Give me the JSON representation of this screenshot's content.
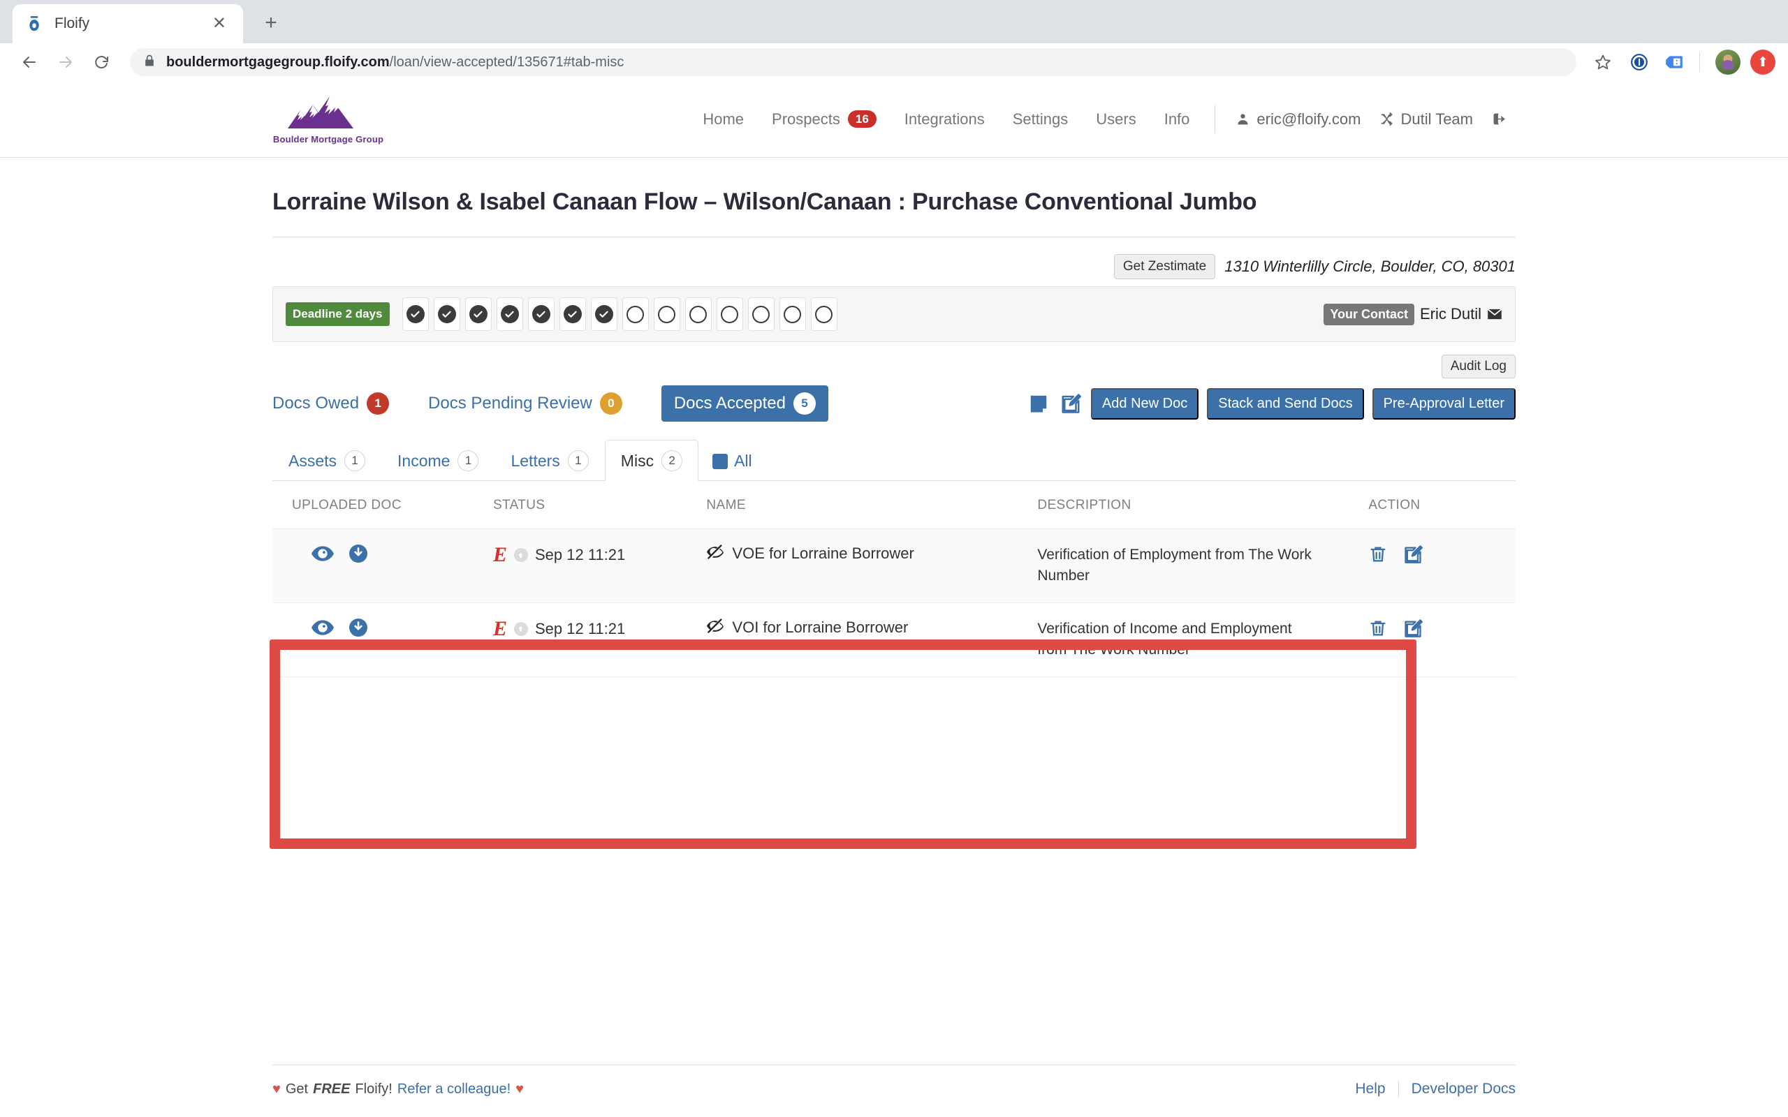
{
  "browser": {
    "tab_title": "Floify",
    "tab_favicon_name": "floify-favicon",
    "close_label": "✕",
    "newtab_label": "+",
    "url_host": "bouldermortgagegroup.floify.com",
    "url_path": "/loan/view-accepted/135671#tab-misc",
    "back_label": "←",
    "forward_label": "→",
    "reload_label": "⟳",
    "star_label": "☆",
    "update_label": "⬆"
  },
  "header": {
    "logo_text": "Boulder Mortgage Group",
    "nav": [
      {
        "label": "Home",
        "badge": null
      },
      {
        "label": "Prospects",
        "badge": "16"
      },
      {
        "label": "Integrations",
        "badge": null
      },
      {
        "label": "Settings",
        "badge": null
      },
      {
        "label": "Users",
        "badge": null
      },
      {
        "label": "Info",
        "badge": null
      }
    ],
    "user_email": "eric@floify.com",
    "team_name": "Dutil Team"
  },
  "loan": {
    "title": "Lorraine Wilson & Isabel Canaan Flow – Wilson/Canaan : Purchase Conventional Jumbo",
    "zestimate_label": "Get Zestimate",
    "address": "1310 Winterlilly Circle, Boulder, CO, 80301",
    "deadline_label": "Deadline 2 days",
    "steps_completed": 7,
    "steps_total": 14,
    "contact_label": "Your Contact",
    "contact_name": "Eric Dutil"
  },
  "toolbar": {
    "audit_log_label": "Audit Log",
    "add_new_doc_label": "Add New Doc",
    "stack_send_label": "Stack and Send Docs",
    "pre_approval_label": "Pre-Approval Letter"
  },
  "doc_status_tabs": [
    {
      "label": "Docs Owed",
      "count": "1",
      "state": "owed",
      "active": false
    },
    {
      "label": "Docs Pending Review",
      "count": "0",
      "state": "pending",
      "active": false
    },
    {
      "label": "Docs Accepted",
      "count": "5",
      "state": "accepted",
      "active": true
    }
  ],
  "category_tabs": [
    {
      "label": "Assets",
      "count": "1",
      "active": false
    },
    {
      "label": "Income",
      "count": "1",
      "active": false
    },
    {
      "label": "Letters",
      "count": "1",
      "active": false
    },
    {
      "label": "Misc",
      "count": "2",
      "active": true
    }
  ],
  "all_filter_label": "All",
  "table": {
    "headers": {
      "uploaded_doc": "UPLOADED DOC",
      "status": "STATUS",
      "name": "NAME",
      "description": "DESCRIPTION",
      "action": "ACTION"
    },
    "rows": [
      {
        "status_source": "E",
        "status_date": "Sep 12 11:21",
        "name": "VOE for Lorraine Borrower",
        "description": "Verification of Employment from The Work Number"
      },
      {
        "status_source": "E",
        "status_date": "Sep 12 11:21",
        "name": "VOI for Lorraine Borrower",
        "description": "Verification of Income and Employment from The Work Number"
      }
    ]
  },
  "footer": {
    "promo_prefix": "Get",
    "promo_free": "FREE",
    "promo_mid": "Floify!",
    "promo_link": "Refer a colleague!",
    "help_label": "Help",
    "dev_docs_label": "Developer Docs"
  },
  "colors": {
    "brand_purple": "#6b2f90",
    "accent_blue": "#3b71a8",
    "danger_red": "#c0392b",
    "warning_orange": "#e0a030",
    "success_green": "#4f8a3d",
    "annotation_red": "#dd4b44"
  }
}
